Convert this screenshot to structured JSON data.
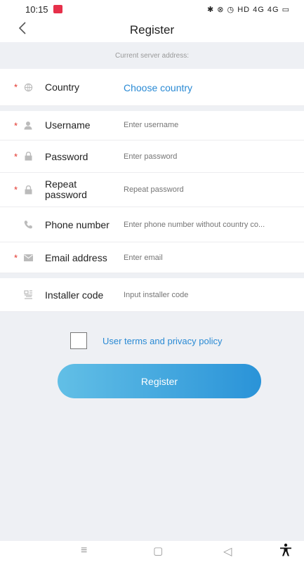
{
  "status": {
    "time": "10:15",
    "right_icons": "✱ ⊗ ◷ HD 4G  4G  ▭"
  },
  "header": {
    "title": "Register"
  },
  "server": {
    "label": "Current server address:"
  },
  "form": {
    "country": {
      "label": "Country",
      "value": "Choose country"
    },
    "username": {
      "label": "Username",
      "placeholder": "Enter username"
    },
    "password": {
      "label": "Password",
      "placeholder": "Enter password"
    },
    "repeat": {
      "label_line1": "Repeat",
      "label_line2": "password",
      "placeholder": "Repeat password"
    },
    "phone": {
      "label": "Phone number",
      "placeholder": "Enter phone number without country co..."
    },
    "email": {
      "label": "Email address",
      "placeholder": "Enter email"
    },
    "installer": {
      "label": "Installer code",
      "placeholder": "Input installer code"
    }
  },
  "terms": {
    "label": "User terms and privacy policy",
    "checked": false
  },
  "register_button": {
    "label": "Register"
  },
  "required_marker": "*",
  "nav": {
    "menu": "≡",
    "home": "▢",
    "back": "◁",
    "accessibility": "🚶"
  },
  "colors": {
    "accent": "#2a8ad4",
    "required": "#e2342b",
    "button_start": "#62bfe6",
    "button_end": "#2a93d8"
  }
}
